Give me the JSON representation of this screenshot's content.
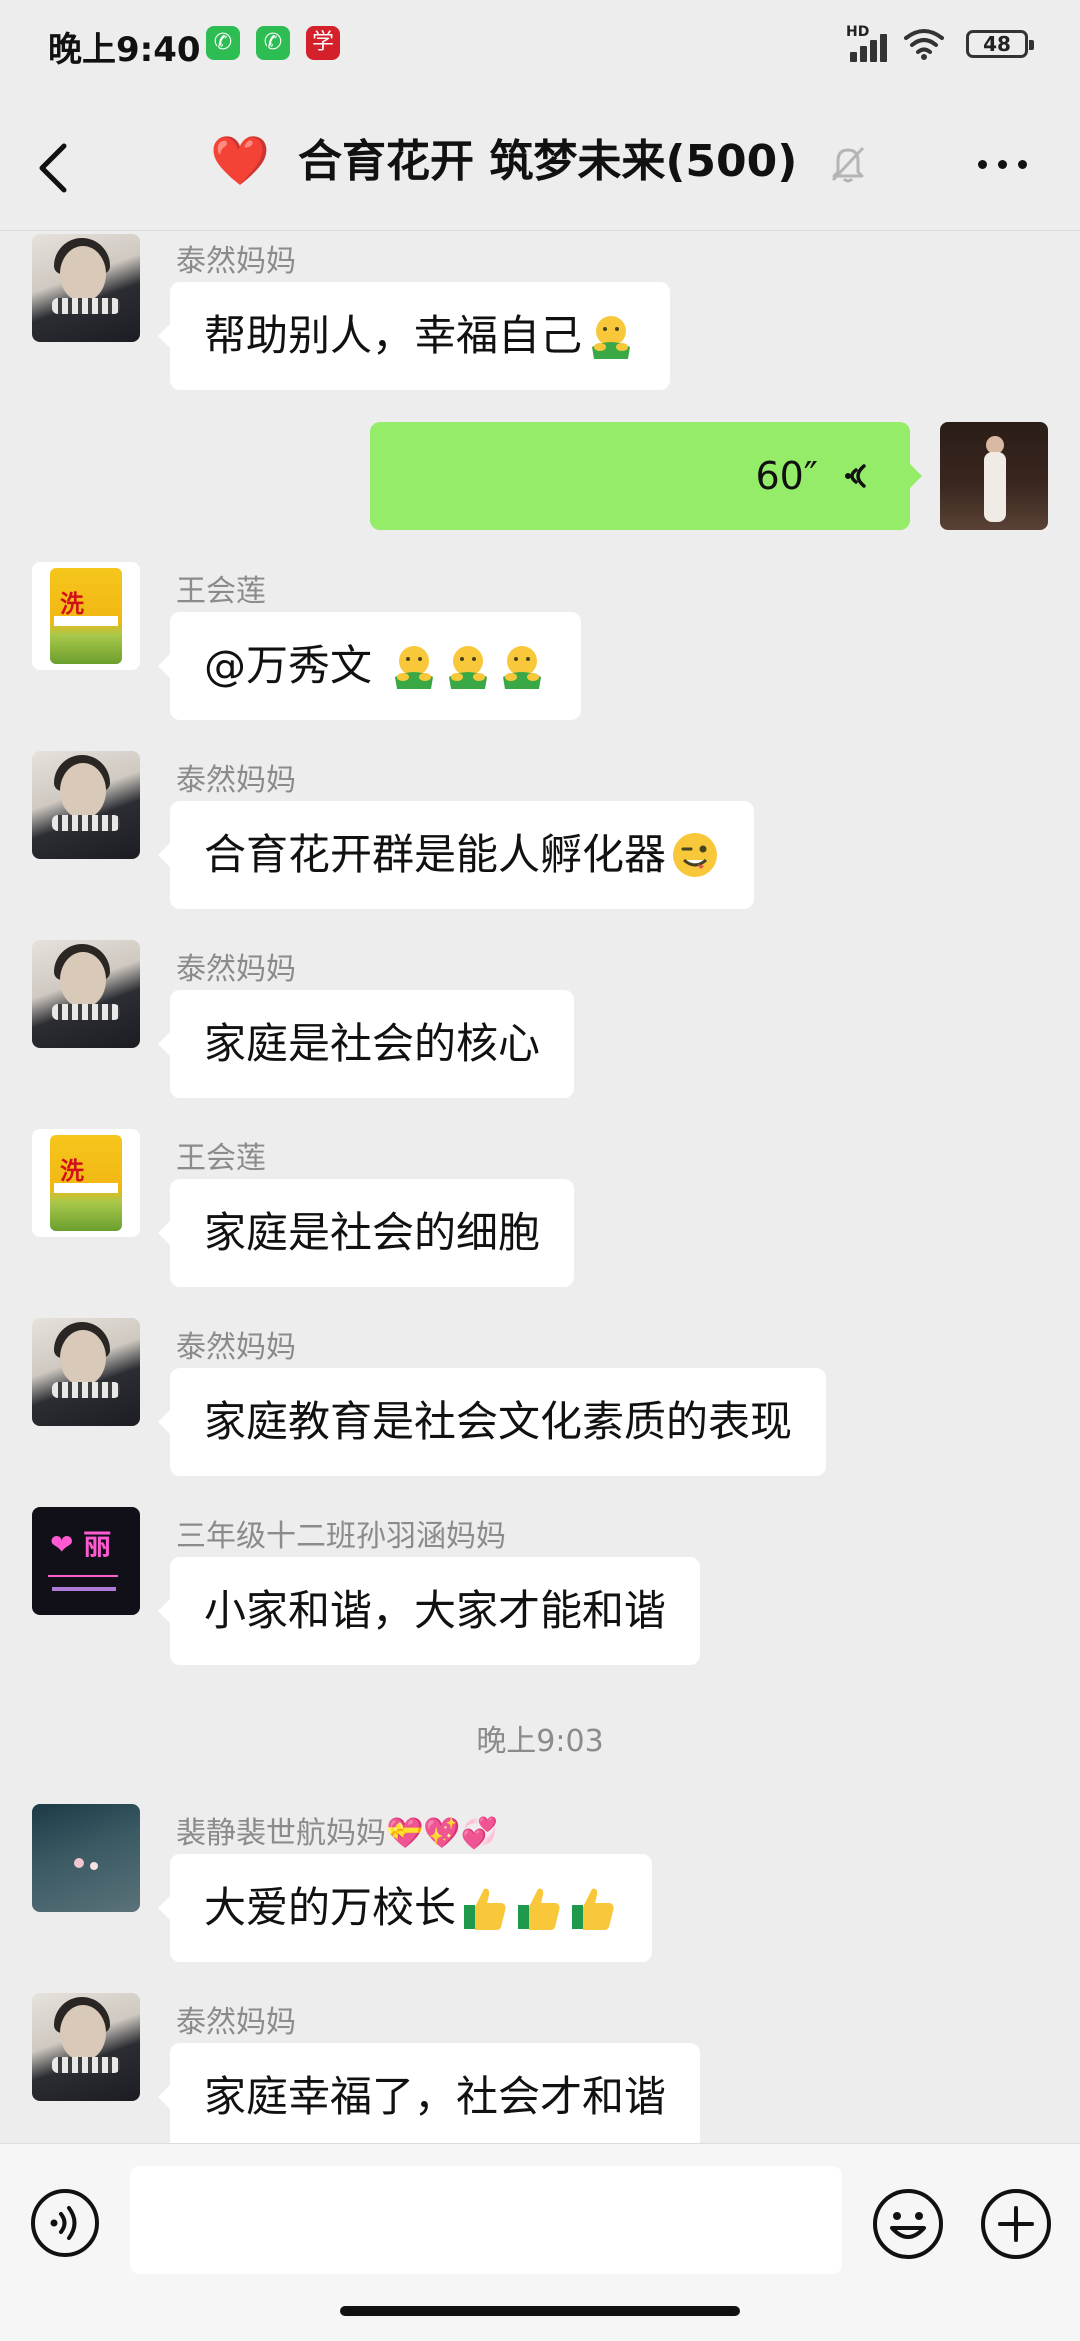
{
  "status_bar": {
    "time": "晚上9:40",
    "network": "HD",
    "battery": "48",
    "app_icons": [
      "wechat-icon",
      "wechat-icon",
      "study-app-icon"
    ]
  },
  "header": {
    "title": "合育花开 筑梦未来(500)",
    "title_emoji": "❤️",
    "back_icon": "chevron-left-icon",
    "mute_icon": "bell-muted-icon",
    "more_icon": "more-dots-icon"
  },
  "messages": [
    {
      "sender": "泰然妈妈",
      "text": "帮助别人，幸福自己",
      "emoji": [
        "hug-emoji"
      ],
      "avatar": "mother"
    },
    {
      "sender": "",
      "voice_duration": "60″",
      "self": true,
      "avatar": "self"
    },
    {
      "sender": "王会莲",
      "text": "@万秀文 ",
      "emoji": [
        "hug-emoji",
        "hug-emoji",
        "hug-emoji"
      ],
      "avatar": "rice"
    },
    {
      "sender": "泰然妈妈",
      "text": "合育花开群是能人孵化器",
      "emoji": [
        "wink-emoji"
      ],
      "avatar": "mother"
    },
    {
      "sender": "泰然妈妈",
      "text": "家庭是社会的核心",
      "avatar": "mother"
    },
    {
      "sender": "王会莲",
      "text": "家庭是社会的细胞",
      "avatar": "rice"
    },
    {
      "sender": "泰然妈妈",
      "text": "家庭教育是社会文化素质的表现",
      "avatar": "mother"
    },
    {
      "sender": "三年级十二班孙羽涵妈妈",
      "text": "小家和谐，大家才能和谐",
      "avatar": "neon"
    },
    {
      "sender": "裴静裴世航妈妈💝💖💞",
      "text": "大爱的万校长",
      "emoji": [
        "thumbs-up-emoji",
        "thumbs-up-emoji",
        "thumbs-up-emoji"
      ],
      "avatar": "sky"
    },
    {
      "sender": "泰然妈妈",
      "text": "家庭幸福了，社会才和谐",
      "avatar": "mother"
    }
  ],
  "timestamp": "晚上9:03",
  "input_bar": {
    "placeholder": "",
    "voice_icon": "voice-input-icon",
    "emoji_icon": "smiley-icon",
    "plus_icon": "plus-circle-icon"
  },
  "colors": {
    "background": "#ededed",
    "self_bubble": "#95ec69",
    "other_bubble": "#ffffff",
    "sender_text": "#8b8b8b"
  }
}
